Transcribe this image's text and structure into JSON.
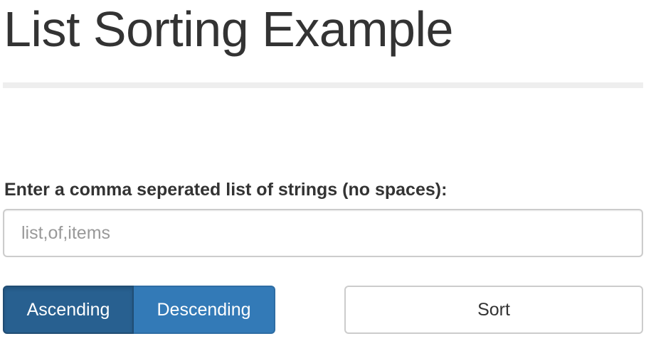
{
  "page": {
    "title": "List Sorting Example"
  },
  "form": {
    "label": "Enter a comma seperated list of strings (no spaces):",
    "input": {
      "placeholder": "list,of,items",
      "value": ""
    }
  },
  "order_toggle": {
    "ascending_label": "Ascending",
    "descending_label": "Descending",
    "selected": "Ascending"
  },
  "actions": {
    "sort_label": "Sort"
  },
  "colors": {
    "primary": "#337ab7",
    "primary_active": "#286090",
    "divider": "#eeeeee",
    "text": "#333333",
    "placeholder": "#999999",
    "border": "#cccccc"
  }
}
